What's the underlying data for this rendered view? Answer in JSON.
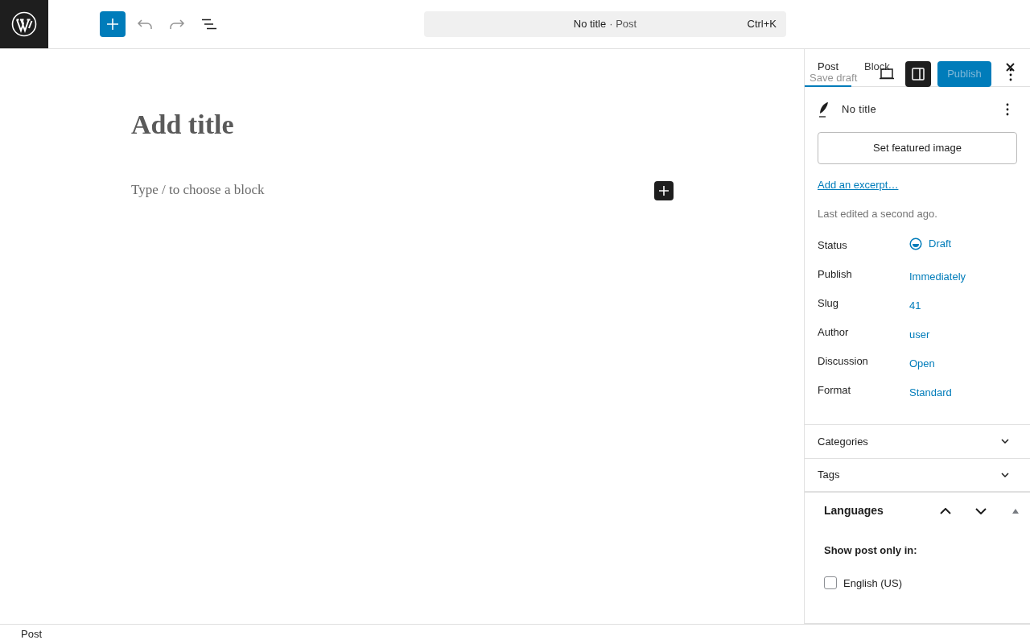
{
  "top_bar": {
    "command_bar": {
      "title": "No title",
      "post_type": "· Post",
      "shortcut": "Ctrl+K"
    }
  },
  "editor": {
    "title_placeholder": "Add title",
    "block_placeholder": "Type / to choose a block"
  },
  "sidebar": {
    "tabs": [
      {
        "label": "Post",
        "selected": true
      },
      {
        "label": "Block",
        "selected": false
      }
    ],
    "save_draft": "Save draft",
    "publish": "Publish",
    "post_summary": {
      "title": "No title",
      "featured_image_button": "Set featured image",
      "excerpt_link": "Add an excerpt…",
      "last_edited": "Last edited a second ago.",
      "fields": [
        {
          "label": "Status",
          "value": "Draft",
          "kind": "status"
        },
        {
          "label": "Publish",
          "value": "Immediately",
          "kind": "link"
        },
        {
          "label": "Slug",
          "value": "41",
          "kind": "link"
        },
        {
          "label": "Author",
          "value": "user",
          "kind": "link"
        },
        {
          "label": "Discussion",
          "value": "Open",
          "kind": "link"
        },
        {
          "label": "Format",
          "value": "Standard",
          "kind": "link"
        }
      ]
    },
    "panels": [
      {
        "title": "Categories",
        "expanded": false
      },
      {
        "title": "Tags",
        "expanded": false
      }
    ],
    "languages": {
      "title": "Languages",
      "expanded": true,
      "heading": "Show post only in:",
      "options": [
        {
          "label": "English (US)",
          "checked": false
        }
      ]
    }
  },
  "status_bar": {
    "breadcrumb": "Post"
  }
}
